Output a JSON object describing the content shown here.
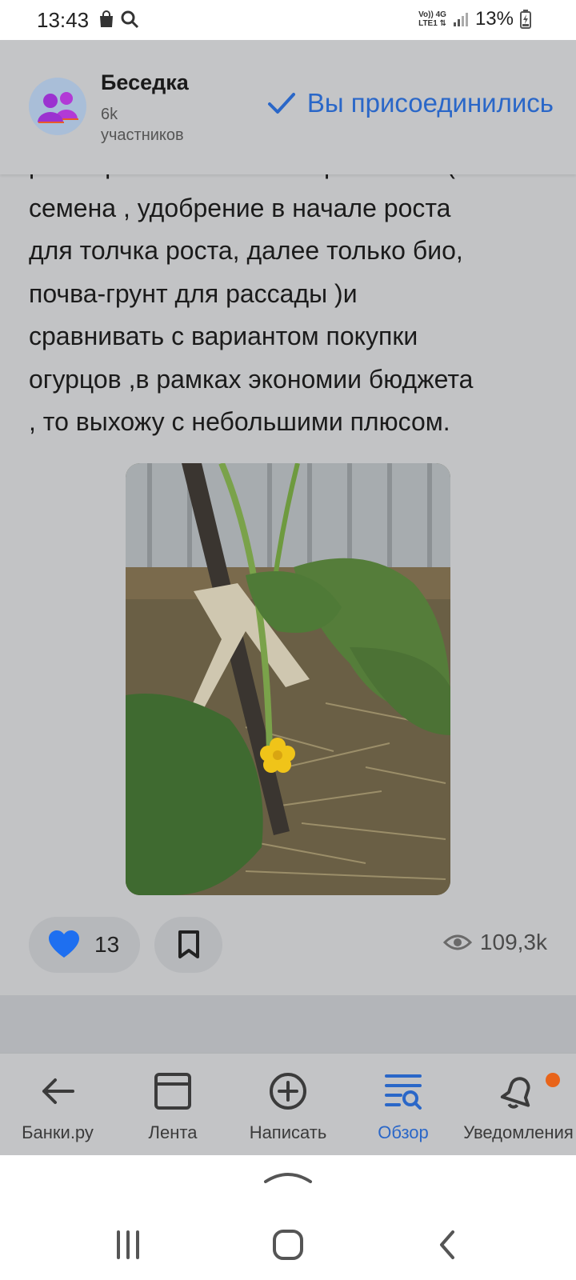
{
  "status_bar": {
    "time": "13:43",
    "network_top": "Vo)) 4G",
    "network_bottom": "LTE1 ⇅",
    "battery_text": "13%"
  },
  "community": {
    "name": "Беседка",
    "members_count": "6k",
    "members_label": "участников",
    "join_status": "Вы присоединились"
  },
  "post": {
    "text": "расширивать в части затрат на все(\nсемена , удобрение в начале роста\nдля толчка роста, далее только био,\nпочва-грунт для рассады  )и\nсравнивать  с вариантом покупки\nогурцов ,в рамках экономии бюджета\n, то выхожу с небольшими плюсом."
  },
  "actions": {
    "likes": "13",
    "views": "109,3k"
  },
  "nav": {
    "items": [
      {
        "label": "Банки.ру",
        "icon": "back-arrow-icon"
      },
      {
        "label": "Лента",
        "icon": "feed-icon"
      },
      {
        "label": "Написать",
        "icon": "plus-circle-icon"
      },
      {
        "label": "Обзор",
        "icon": "search-list-icon",
        "active": true
      },
      {
        "label": "Уведомления",
        "icon": "bell-icon",
        "badge": true
      }
    ]
  },
  "colors": {
    "accent": "#2a67c8",
    "like": "#1e6ff0",
    "badge": "#e8641a"
  }
}
